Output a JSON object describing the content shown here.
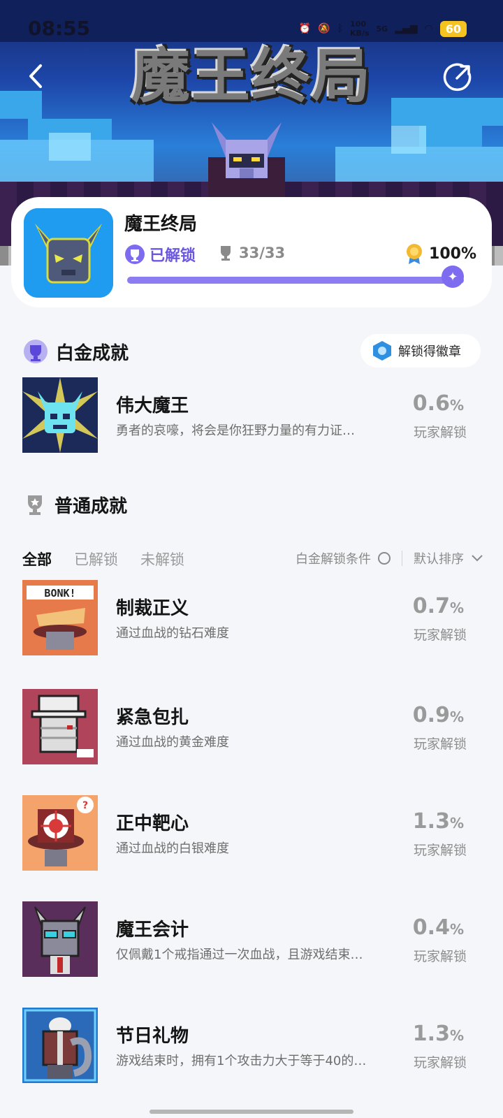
{
  "status_bar": {
    "time": "08:55",
    "net_speed_top": "100",
    "net_speed_bottom": "KB/s",
    "network": "5G",
    "battery": "60"
  },
  "banner": {
    "logo_text": "魔王终局"
  },
  "game": {
    "title": "魔王终局",
    "unlock_status": "已解锁",
    "trophy_count": "33/33",
    "completion": "100%",
    "progress": 1.0
  },
  "platinum": {
    "section_title": "白金成就",
    "badge_button": "解锁得徽章",
    "item": {
      "name": "伟大魔王",
      "desc": "勇者的哀嚎，将会是你狂野力量的有力证…",
      "percent": "0.6",
      "unit": "%",
      "sub": "玩家解锁"
    }
  },
  "normal": {
    "section_title": "普通成就",
    "tabs": [
      "全部",
      "已解锁",
      "未解锁"
    ],
    "filter_label": "白金解锁条件",
    "sort_label": "默认排序",
    "items": [
      {
        "name": "制裁正义",
        "desc": "通过血战的钻石难度",
        "percent": "0.7",
        "unit": "%",
        "sub": "玩家解锁"
      },
      {
        "name": "紧急包扎",
        "desc": "通过血战的黄金难度",
        "percent": "0.9",
        "unit": "%",
        "sub": "玩家解锁"
      },
      {
        "name": "正中靶心",
        "desc": "通过血战的白银难度",
        "percent": "1.3",
        "unit": "%",
        "sub": "玩家解锁"
      },
      {
        "name": "魔王会计",
        "desc": "仅佩戴1个戒指通过一次血战，且游戏结束…",
        "percent": "0.4",
        "unit": "%",
        "sub": "玩家解锁"
      },
      {
        "name": "节日礼物",
        "desc": "游戏结束时，拥有1个攻击力大于等于40的…",
        "percent": "1.3",
        "unit": "%",
        "sub": "玩家解锁"
      }
    ]
  },
  "colors": {
    "accent": "#7e6cf0",
    "progress_track": "#e7e4fa",
    "page_bg": "#f4f6f9"
  }
}
